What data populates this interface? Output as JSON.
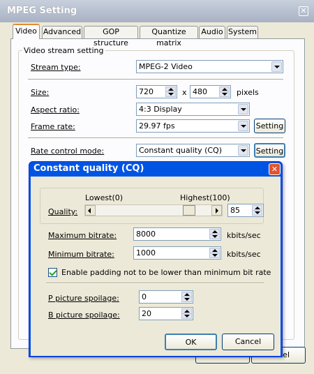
{
  "window": {
    "title": "MPEG Setting",
    "close_glyph": "✕"
  },
  "tabs": [
    {
      "label": "Video",
      "active": true
    },
    {
      "label": "Advanced"
    },
    {
      "label": "GOP structure"
    },
    {
      "label": "Quantize matrix"
    },
    {
      "label": "Audio"
    },
    {
      "label": "System"
    }
  ],
  "video": {
    "group_title": "Video stream setting",
    "stream_type": {
      "label": "Stream type:",
      "value": "MPEG-2 Video"
    },
    "size": {
      "label": "Size:",
      "width": "720",
      "separator": "x",
      "height": "480",
      "unit": "pixels"
    },
    "aspect_ratio": {
      "label": "Aspect ratio:",
      "value": "4:3 Display"
    },
    "frame_rate": {
      "label": "Frame rate:",
      "value": "29.97 fps",
      "setting_label": "Setting"
    },
    "rate_control": {
      "label": "Rate control mode:",
      "value": "Constant quality (CQ)",
      "setting_label": "Setting"
    }
  },
  "main_buttons": {
    "cancel_partial": "el"
  },
  "cq_dialog": {
    "title": "Constant quality (CQ)",
    "close_glyph": "✕",
    "quality": {
      "label": "Quality:",
      "low_label": "Lowest(0)",
      "high_label": "Highest(100)",
      "value": "85",
      "level": 0.85
    },
    "max_bitrate": {
      "label": "Maximum bitrate:",
      "value": "8000",
      "unit": "kbits/sec"
    },
    "min_bitrate": {
      "label": "Minimum bitrate:",
      "value": "1000",
      "unit": "kbits/sec"
    },
    "padding": {
      "label": "Enable padding not to be lower than minimum bit rate",
      "checked": true
    },
    "p_spoilage": {
      "label": "P picture spoilage:",
      "value": "0"
    },
    "b_spoilage": {
      "label": "B picture spoilage:",
      "value": "20"
    },
    "ok_label": "OK",
    "cancel_label": "Cancel"
  },
  "colors": {
    "titlebar_active": "#0054e3",
    "titlebar_inactive": "#a8b2c4",
    "tab_highlight": "#e68b2c",
    "window_bg": "#ece9d8",
    "check": "#21a121"
  }
}
